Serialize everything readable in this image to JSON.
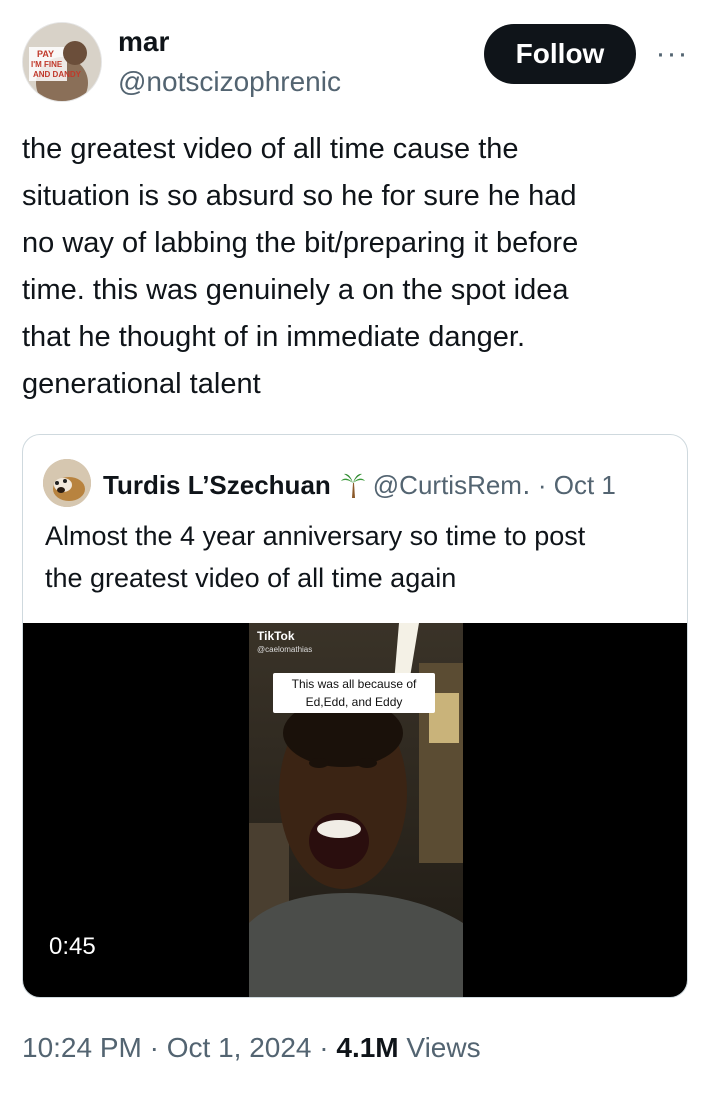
{
  "author": {
    "display_name": "mar",
    "handle": "@notscizophrenic",
    "avatar_text": "PAY I'M FINE AND DANDY"
  },
  "actions": {
    "follow_label": "Follow",
    "more_label": "···"
  },
  "tweet": {
    "text": "the greatest video of all time cause the\nsituation is so absurd so he for sure he had\nno way of labbing the bit/preparing it before\ntime. this was genuinely a on the spot idea\nthat he thought of in immediate danger.\ngenerational talent"
  },
  "quoted": {
    "display_name": "Turdis L’Szechuan",
    "emoji_icon": "palm-tree-icon",
    "handle_date": "@CurtisRem․ · Oct 1",
    "text": "Almost the 4 year anniversary so time to post\nthe greatest video of all time again",
    "video": {
      "tiktok_logo": "TikTok",
      "tiktok_handle": "@caelomathias",
      "caption": "This was all because of Ed,Edd, and Eddy",
      "duration": "0:45"
    }
  },
  "footer": {
    "time_date": "10:24 PM · Oct 1, 2024 · ",
    "views_count": "4.1M",
    "views_label": " Views"
  }
}
